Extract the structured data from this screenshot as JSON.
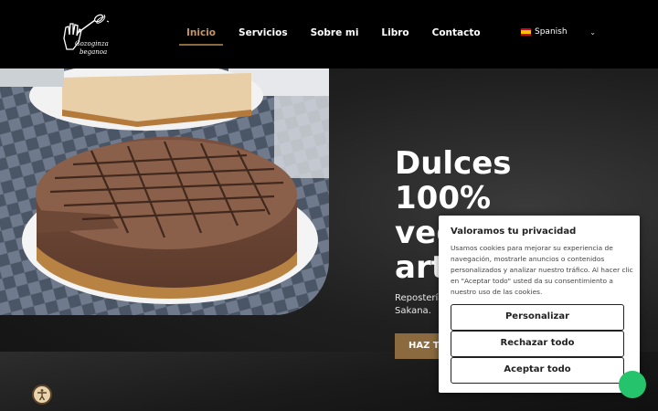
{
  "brand": {
    "line1": "Gozoginza",
    "line2": "beganoa",
    "icon": "whisk-hand-logo-icon"
  },
  "nav": {
    "items": [
      {
        "label": "Inicio",
        "active": true
      },
      {
        "label": "Servicios",
        "active": false
      },
      {
        "label": "Sobre mi",
        "active": false
      },
      {
        "label": "Libro",
        "active": false
      },
      {
        "label": "Contacto",
        "active": false
      }
    ],
    "accent_color": "#c69463"
  },
  "language": {
    "selected": "Spanish",
    "flag_icon": "spain-flag-icon",
    "chevron_icon": "chevron-down-icon"
  },
  "hero": {
    "title_lines": [
      "Dulces",
      "100%",
      "veg",
      "art"
    ],
    "subtitle_lines": [
      "Repostería",
      "Sakana."
    ],
    "cta_label": "HAZ TU",
    "cta_color": "#8a6a3e",
    "image_icon": "cheesecake-photo"
  },
  "cookie_banner": {
    "title": "Valoramos tu privacidad",
    "text_lines": [
      "Usamos cookies para mejorar su experiencia de",
      "navegación, mostrarle anuncios o contenidos",
      "personalizados y analizar nuestro tráfico. Al hacer clic",
      "en \"Aceptar todo\" usted da su consentimiento a",
      "nuestro uso de las cookies."
    ],
    "customize_label": "Personalizar",
    "reject_label": "Rechazar todo",
    "accept_label": "Aceptar todo"
  },
  "widgets": {
    "accessibility_icon": "accessibility-icon",
    "chat_icon": "whatsapp-chat-icon"
  }
}
